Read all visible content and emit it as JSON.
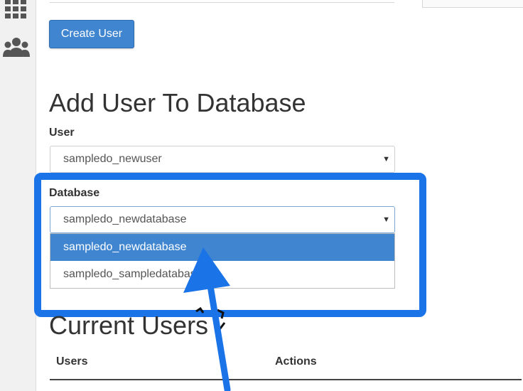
{
  "sidebar": {
    "items": [
      {
        "icon": "apps-grid-icon"
      },
      {
        "icon": "users-icon"
      }
    ]
  },
  "actions": {
    "create_user_label": "Create User"
  },
  "add_user_section": {
    "title": "Add User To Database",
    "user_label": "User",
    "user_value": "sampledo_newuser",
    "database_label": "Database",
    "database_value": "sampledo_newdatabase",
    "database_options": [
      "sampledo_newdatabase",
      "sampledo_sampledatabase"
    ]
  },
  "current_users_section": {
    "title": "Current Users",
    "columns": [
      "Users",
      "Actions"
    ]
  },
  "colors": {
    "primary": "#3f85cf",
    "annotation_blue": "#1b73e8"
  }
}
